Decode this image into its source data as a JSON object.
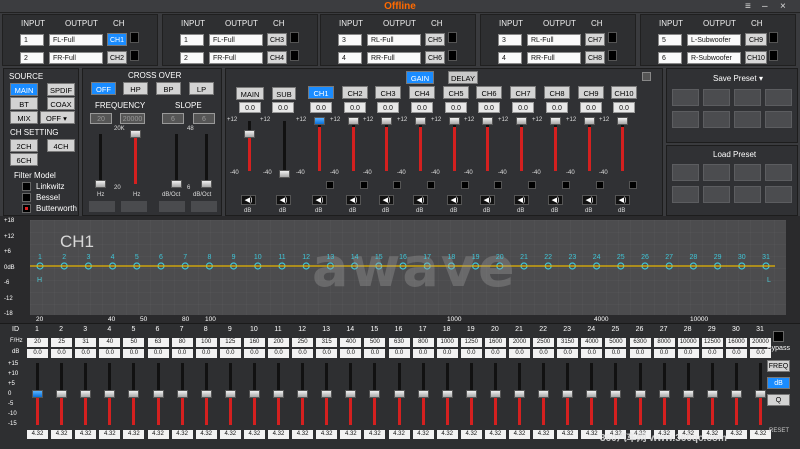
{
  "window": {
    "title": "Offline",
    "controls": [
      "≡",
      "–",
      "×"
    ]
  },
  "routing": {
    "headers": {
      "input": "INPUT",
      "output": "OUTPUT",
      "ch": "CH"
    },
    "groups": [
      {
        "rows": [
          {
            "num": "1",
            "out": "FL-Full",
            "ch": "CH1",
            "active": true
          },
          {
            "num": "2",
            "out": "FR-Full",
            "ch": "CH2",
            "active": false
          }
        ]
      },
      {
        "rows": [
          {
            "num": "1",
            "out": "FL-Full",
            "ch": "CH3",
            "active": false
          },
          {
            "num": "2",
            "out": "FR-Full",
            "ch": "CH4",
            "active": false
          }
        ]
      },
      {
        "rows": [
          {
            "num": "3",
            "out": "RL-Full",
            "ch": "CH5",
            "active": false
          },
          {
            "num": "4",
            "out": "RR-Full",
            "ch": "CH6",
            "active": false
          }
        ]
      },
      {
        "rows": [
          {
            "num": "3",
            "out": "RL-Full",
            "ch": "CH7",
            "active": false
          },
          {
            "num": "4",
            "out": "RR-Full",
            "ch": "CH8",
            "active": false
          }
        ]
      },
      {
        "rows": [
          {
            "num": "5",
            "out": "L-Subwoofer",
            "ch": "CH9",
            "active": false
          },
          {
            "num": "6",
            "out": "R-Subwoofer",
            "ch": "CH10",
            "active": false
          }
        ]
      }
    ]
  },
  "source": {
    "title": "SOURCE",
    "buttons": [
      "MAIN",
      "SPDIF",
      "BT",
      "COAX",
      "MIX",
      "OFF"
    ],
    "active": "MAIN"
  },
  "chsetting": {
    "title": "CH SETTING",
    "buttons": [
      "2CH",
      "4CH",
      "6CH"
    ]
  },
  "filtermodel": {
    "title": "Filter Model",
    "items": [
      "Linkwitz",
      "Bessel",
      "Butterworth"
    ]
  },
  "crossover": {
    "title": "CROSS OVER",
    "buttons": [
      "OFF",
      "HP",
      "BP",
      "LP"
    ],
    "active": "OFF",
    "freq_label": "FREQUENCY",
    "slope_label": "SLOPE",
    "freq_vals": [
      "20",
      "20000"
    ],
    "slope_vals": [
      "6",
      "6"
    ],
    "freq_top": "20K",
    "freq_bot": "20",
    "freq_unit": "Hz",
    "slope_top": "48",
    "slope_bot": "6",
    "slope_unit": "dB/Oct"
  },
  "mixer": {
    "tabs": [
      "GAIN",
      "DELAY"
    ],
    "active_tab": "GAIN",
    "main_label": "MAIN",
    "sub_label": "SUB",
    "main_val": "0.0",
    "sub_val": "0.0",
    "scale_top": "+12",
    "scale_bot": "-40",
    "db": "dB",
    "channels": [
      "CH1",
      "CH2",
      "CH3",
      "CH4",
      "CH5",
      "CH6",
      "CH7",
      "CH8",
      "CH9",
      "CH10"
    ],
    "values": [
      "0.0",
      "0.0",
      "0.0",
      "0.0",
      "0.0",
      "0.0",
      "0.0",
      "0.0",
      "0.0",
      "0.0"
    ],
    "active": "CH1",
    "scale_labels": [
      "+12",
      "-40"
    ]
  },
  "presets": {
    "save_title": "Save Preset",
    "load_title": "Load Preset"
  },
  "eq": {
    "channel": "CH1",
    "watermark": "awave",
    "ylabels": [
      "+18",
      "+12",
      "+6",
      "0dB",
      "-6",
      "-12",
      "-18"
    ],
    "xlabels": [
      "20",
      "40",
      "50",
      "80",
      "100",
      "1000",
      "4000",
      "10000"
    ],
    "points": [
      "1",
      "2",
      "3",
      "4",
      "5",
      "6",
      "7",
      "8",
      "9",
      "10",
      "11",
      "12",
      "13",
      "14",
      "15",
      "16",
      "17",
      "18",
      "19",
      "20",
      "21",
      "22",
      "23",
      "24",
      "25",
      "26",
      "27",
      "28",
      "29",
      "30",
      "31"
    ],
    "hi_label": "H",
    "lo_label": "L"
  },
  "bands": {
    "row_labels": {
      "id": "ID",
      "f": "F/Hz",
      "db": "dB"
    },
    "scale": [
      "+15",
      "+10",
      "+5",
      "0",
      "-5",
      "-10",
      "-15"
    ],
    "freqs": [
      "20",
      "25",
      "31",
      "40",
      "50",
      "63",
      "80",
      "100",
      "125",
      "160",
      "200",
      "250",
      "315",
      "400",
      "500",
      "630",
      "800",
      "1000",
      "1250",
      "1600",
      "2000",
      "2500",
      "3150",
      "4000",
      "5000",
      "6300",
      "8000",
      "10000",
      "12500",
      "16000",
      "20000"
    ],
    "gains": [
      "0.0",
      "0.0",
      "0.0",
      "0.0",
      "0.0",
      "0.0",
      "0.0",
      "0.0",
      "0.0",
      "0.0",
      "0.0",
      "0.0",
      "0.0",
      "0.0",
      "0.0",
      "0.0",
      "0.0",
      "0.0",
      "0.0",
      "0.0",
      "0.0",
      "0.0",
      "0.0",
      "0.0",
      "0.0",
      "0.0",
      "0.0",
      "0.0",
      "0.0",
      "0.0",
      "0.0"
    ],
    "q": "4.32",
    "right": {
      "bypass": "Bypass",
      "freq": "FREQ",
      "db": "dB",
      "q": "Q",
      "reset": "RESET"
    },
    "active_mode": "dB"
  },
  "watermark": {
    "text": "360汽车网 www.360qc.com"
  }
}
